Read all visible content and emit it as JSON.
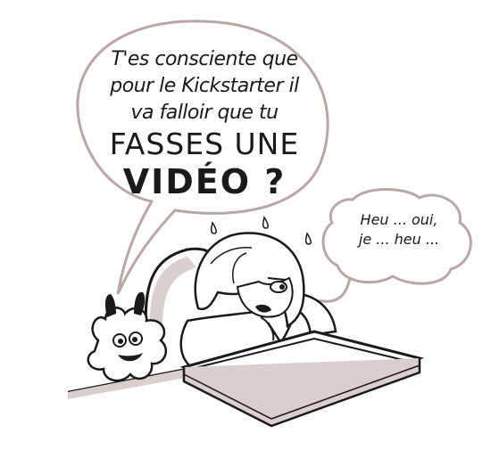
{
  "speech": {
    "big_bubble": {
      "line1": "T'es consciente que",
      "line2": "pour le Kickstarter il",
      "line3": "va falloir que tu",
      "line4": "FASSES UNE",
      "line5": "VIDÉO ?"
    },
    "small_bubble": {
      "line1": "Heu ... oui,",
      "line2": "je ... heu ..."
    }
  },
  "colors": {
    "ink": "#1a1a1a",
    "bubble_outline": "#b9a7a7",
    "shade": "#d9cfcf",
    "paper": "#ffffff"
  }
}
